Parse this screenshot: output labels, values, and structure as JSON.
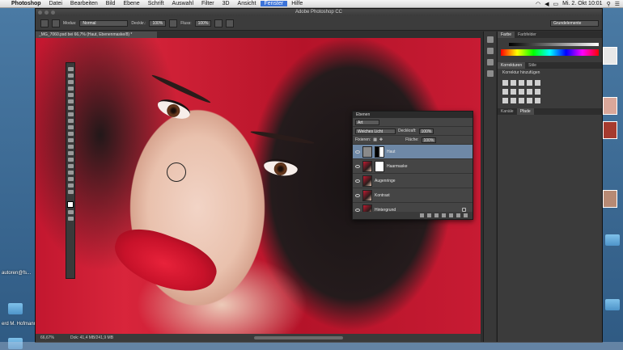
{
  "menubar": {
    "app": "Photoshop",
    "items": [
      "Datei",
      "Bearbeiten",
      "Bild",
      "Ebene",
      "Schrift",
      "Auswahl",
      "Filter",
      "3D",
      "Ansicht",
      "Fenster",
      "Hilfe"
    ],
    "active_item": "Fenster",
    "clock": "Mi. 2. Okt  10:01"
  },
  "window": {
    "title": "Adobe Photoshop CC"
  },
  "options": {
    "mode_label": "Modus:",
    "mode_value": "Normal",
    "opacity_label": "Deckkr.:",
    "opacity_value": "100%",
    "flow_label": "Fluss:",
    "flow_value": "100%",
    "workspace": "Grundelemente"
  },
  "document": {
    "tab": "_MG_7060.psd bei 66,7% (Haut, Ebenenmaske/8) *",
    "zoom": "66,67%",
    "doc_size": "Dok: 41,4 MB/241,9 MB"
  },
  "color_panel": {
    "tabs": [
      "Farbe",
      "Farbfelder"
    ],
    "active": "Farbe"
  },
  "adjustments_panel": {
    "tabs": [
      "Korrekturen",
      "Stile"
    ],
    "title": "Korrektur hinzufügen"
  },
  "lower_panel": {
    "tabs": [
      "Kanäle",
      "Pfade"
    ]
  },
  "layers_panel": {
    "title": "Ebenen",
    "filter": "Art",
    "blend_mode": "Weiches Licht",
    "opacity_label": "Deckkraft:",
    "opacity_value": "100%",
    "lock_label": "Fixieren:",
    "fill_label": "Fläche:",
    "fill_value": "100%",
    "layers": [
      {
        "name": "Haut",
        "selected": true,
        "mask": true
      },
      {
        "name": "Haarmaske",
        "selected": false,
        "mask": true
      },
      {
        "name": "Augenringe",
        "selected": false,
        "mask": false
      },
      {
        "name": "Kontrast",
        "selected": false,
        "mask": false
      },
      {
        "name": "Hintergrund",
        "selected": false,
        "mask": false,
        "locked": true
      }
    ]
  },
  "desktop": {
    "labels": [
      "autoren@fs...",
      "erd M. Hofmann"
    ]
  }
}
